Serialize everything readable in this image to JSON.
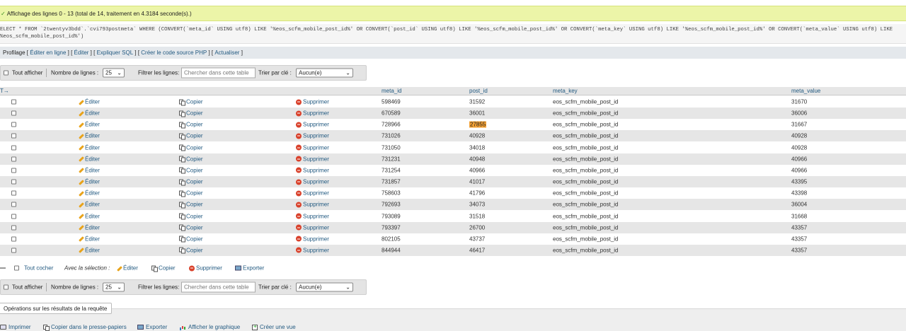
{
  "status": {
    "message": "Affichage des lignes 0 - 13 (total de 14, traitement en 4.3184 seconde(s).)",
    "color": "#ecf5a8"
  },
  "sql": {
    "line1_prefix": "ELECT * FROM `2twentyv3bdd`.`cvi793postmeta` WHERE (CONVERT(`meta_id` USING utf8) LIKE '%eos_scfm_mobile_post_id%' OR CONVERT(`post_id` USING utf8) LIKE '%eos_scfm_mobile_post_id%' OR CONVERT(`meta_key` USING utf8) LIKE '%eos_scfm_mobile_post_id%' OR CONVERT(`meta_value` USING utf8) LIKE",
    "line2": "%eos_scfm_mobile_post_id%')"
  },
  "query_links": {
    "profiling": "Profilage",
    "items": [
      "Éditer en ligne",
      "Éditer",
      "Expliquer SQL",
      "Créer le code source PHP",
      "Actualiser"
    ]
  },
  "navigation": {
    "show_all": "Tout afficher",
    "rows_label": "Nombre de lignes :",
    "rows_value": "25",
    "filter_label": "Filtrer les lignes:",
    "filter_placeholder": "Chercher dans cette table",
    "sort_label": "Trier par clé :",
    "sort_value": "Aucun(e)"
  },
  "table": {
    "arrows": "T→",
    "columns": [
      "meta_id",
      "post_id",
      "meta_key",
      "meta_value"
    ],
    "action_labels": {
      "edit": "Éditer",
      "copy": "Copier",
      "delete": "Supprimer"
    },
    "highlight_color": "#f3a033",
    "rows": [
      {
        "meta_id": "598469",
        "post_id": "31592",
        "meta_key": "eos_scfm_mobile_post_id",
        "meta_value": "31670"
      },
      {
        "meta_id": "670589",
        "post_id": "36001",
        "meta_key": "eos_scfm_mobile_post_id",
        "meta_value": "36006"
      },
      {
        "meta_id": "728966",
        "post_id": "27855",
        "meta_key": "eos_scfm_mobile_post_id",
        "meta_value": "31667",
        "highlight": "post_id"
      },
      {
        "meta_id": "731026",
        "post_id": "40928",
        "meta_key": "eos_scfm_mobile_post_id",
        "meta_value": "40928"
      },
      {
        "meta_id": "731050",
        "post_id": "34018",
        "meta_key": "eos_scfm_mobile_post_id",
        "meta_value": "40928"
      },
      {
        "meta_id": "731231",
        "post_id": "40948",
        "meta_key": "eos_scfm_mobile_post_id",
        "meta_value": "40966"
      },
      {
        "meta_id": "731254",
        "post_id": "40966",
        "meta_key": "eos_scfm_mobile_post_id",
        "meta_value": "40966"
      },
      {
        "meta_id": "731857",
        "post_id": "41017",
        "meta_key": "eos_scfm_mobile_post_id",
        "meta_value": "43395"
      },
      {
        "meta_id": "758603",
        "post_id": "41796",
        "meta_key": "eos_scfm_mobile_post_id",
        "meta_value": "43398"
      },
      {
        "meta_id": "792693",
        "post_id": "34073",
        "meta_key": "eos_scfm_mobile_post_id",
        "meta_value": "36004"
      },
      {
        "meta_id": "793089",
        "post_id": "31518",
        "meta_key": "eos_scfm_mobile_post_id",
        "meta_value": "31668"
      },
      {
        "meta_id": "793397",
        "post_id": "26700",
        "meta_key": "eos_scfm_mobile_post_id",
        "meta_value": "43357"
      },
      {
        "meta_id": "802105",
        "post_id": "43737",
        "meta_key": "eos_scfm_mobile_post_id",
        "meta_value": "43357"
      },
      {
        "meta_id": "844944",
        "post_id": "46417",
        "meta_key": "eos_scfm_mobile_post_id",
        "meta_value": "43357"
      }
    ]
  },
  "bulk": {
    "check_all": "Tout cocher",
    "with_selection": "Avec la sélection :",
    "edit": "Éditer",
    "copy": "Copier",
    "delete": "Supprimer",
    "export": "Exporter"
  },
  "operations": {
    "title": "Opérations sur les résultats de la requête",
    "print": "Imprimer",
    "copy_clipboard": "Copier dans le presse-papiers",
    "export": "Exporter",
    "chart": "Afficher le graphique",
    "create_view": "Créer une vue"
  }
}
